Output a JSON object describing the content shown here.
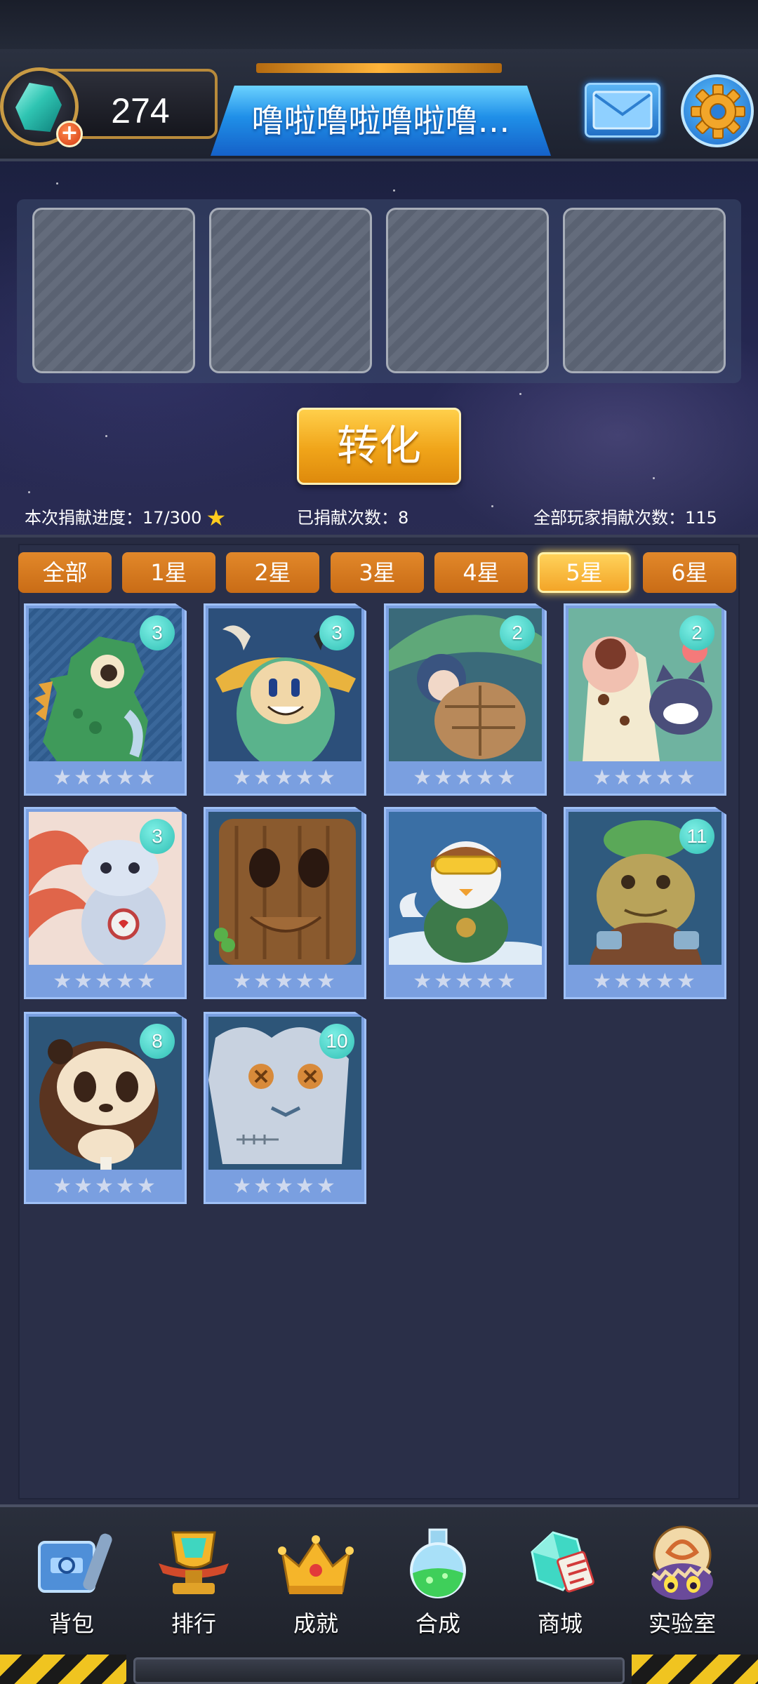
{
  "header": {
    "gem_count": "274",
    "title": "噜啦噜啦噜啦噜…"
  },
  "convert": {
    "button_label": "转化"
  },
  "stats": {
    "progress": "本次捐献进度：17/300",
    "donated": "已捐献次数：8",
    "all_players": "全部玩家捐献次数：115"
  },
  "tabs": [
    {
      "label": "全部"
    },
    {
      "label": "1星"
    },
    {
      "label": "2星"
    },
    {
      "label": "3星"
    },
    {
      "label": "4星"
    },
    {
      "label": "5星",
      "active": true
    },
    {
      "label": "6星"
    }
  ],
  "cards": [
    {
      "art": "green-dinosaur",
      "count": "3"
    },
    {
      "art": "green-horned-creature",
      "count": "3"
    },
    {
      "art": "leaf-elf-with-shell",
      "count": "2"
    },
    {
      "art": "dessert-cat",
      "count": "2"
    },
    {
      "art": "robot-fox",
      "count": "3"
    },
    {
      "art": "tree-stump",
      "count": ""
    },
    {
      "art": "pilot-penguin",
      "count": ""
    },
    {
      "art": "toad-sage",
      "count": "11"
    },
    {
      "art": "panda-lollipop",
      "count": "8"
    },
    {
      "art": "voodoo-sack",
      "count": "10"
    }
  ],
  "nav": [
    {
      "label": "背包",
      "icon": "backpack-icon"
    },
    {
      "label": "排行",
      "icon": "trophy-icon"
    },
    {
      "label": "成就",
      "icon": "crown-icon"
    },
    {
      "label": "合成",
      "icon": "potion-flask-icon"
    },
    {
      "label": "商城",
      "icon": "shop-gem-icon"
    },
    {
      "label": "实验室",
      "icon": "egg-monster-icon"
    }
  ],
  "colors": {
    "tab_orange": "#d97a1f",
    "tab_active": "#ffd25a",
    "badge_teal": "#3fcfc2",
    "card_blue": "#7a9fe0"
  }
}
